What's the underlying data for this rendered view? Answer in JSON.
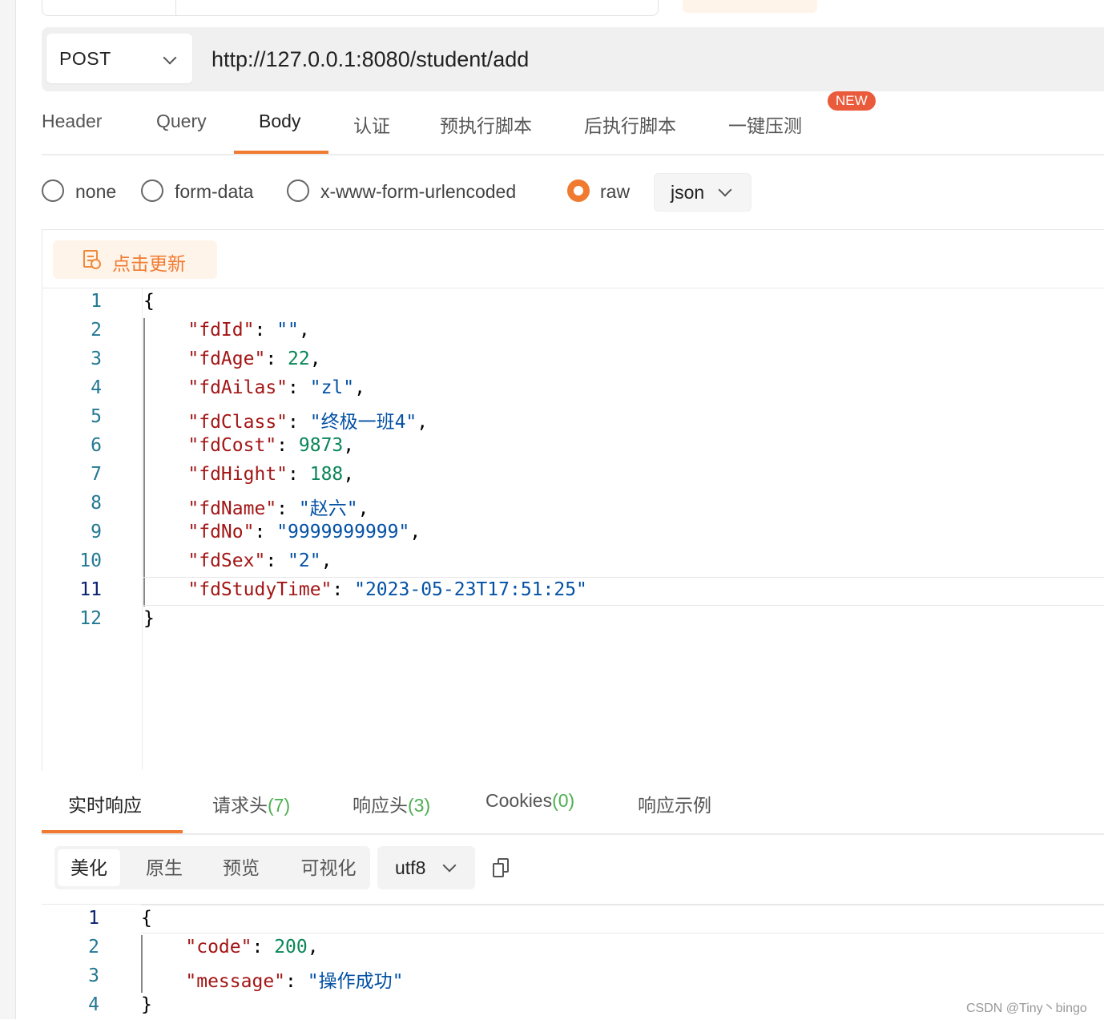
{
  "request": {
    "method": "POST",
    "url": "http://127.0.0.1:8080/student/add"
  },
  "tabs": {
    "items": [
      "Header",
      "Query",
      "Body",
      "认证",
      "预执行脚本",
      "后执行脚本",
      "一键压测"
    ],
    "active": "Body",
    "new_badge": "NEW"
  },
  "body_modes": {
    "options": [
      "none",
      "form-data",
      "x-www-form-urlencoded",
      "raw"
    ],
    "selected": "raw",
    "format": "json"
  },
  "editor": {
    "update_button": "点击更新",
    "current_line": 11,
    "line_numbers": [
      "1",
      "2",
      "3",
      "4",
      "5",
      "6",
      "7",
      "8",
      "9",
      "10",
      "11",
      "12"
    ],
    "lines": {
      "open": "{",
      "l2": {
        "key": "\"fdId\"",
        "value": "\"\""
      },
      "l3": {
        "key": "\"fdAge\"",
        "value": "22"
      },
      "l4": {
        "key": "\"fdAilas\"",
        "value": "\"zl\""
      },
      "l5": {
        "key": "\"fdClass\"",
        "value": "\"终极一班4\""
      },
      "l6": {
        "key": "\"fdCost\"",
        "value": "9873"
      },
      "l7": {
        "key": "\"fdHight\"",
        "value": "188"
      },
      "l8": {
        "key": "\"fdName\"",
        "value": "\"赵六\""
      },
      "l9": {
        "key": "\"fdNo\"",
        "value": "\"9999999999\""
      },
      "l10": {
        "key": "\"fdSex\"",
        "value": "\"2\""
      },
      "l11": {
        "key": "\"fdStudyTime\"",
        "value": "\"2023-05-23T17:51:25\""
      },
      "close": "}"
    }
  },
  "response": {
    "tabs": {
      "realtime": "实时响应",
      "req_headers": "请求头",
      "req_headers_count": "(7)",
      "resp_headers": "响应头",
      "resp_headers_count": "(3)",
      "cookies": "Cookies",
      "cookies_count": "(0)",
      "examples": "响应示例"
    },
    "formats": [
      "美化",
      "原生",
      "预览",
      "可视化"
    ],
    "active_format": "美化",
    "encoding": "utf8",
    "line_numbers": [
      "1",
      "2",
      "3",
      "4"
    ],
    "lines": {
      "open": "{",
      "l2": {
        "key": "\"code\"",
        "value": "200"
      },
      "l3": {
        "key": "\"message\"",
        "value": "\"操作成功\""
      },
      "close": "}"
    }
  },
  "watermark": "CSDN @Tiny丶bingo",
  "colors": {
    "accent": "#f07a2f",
    "json_key": "#a31515",
    "json_string": "#0451a5",
    "json_number": "#098658",
    "line_number": "#237893",
    "new_badge": "#ea5b3b",
    "count_green": "#4caf50"
  }
}
